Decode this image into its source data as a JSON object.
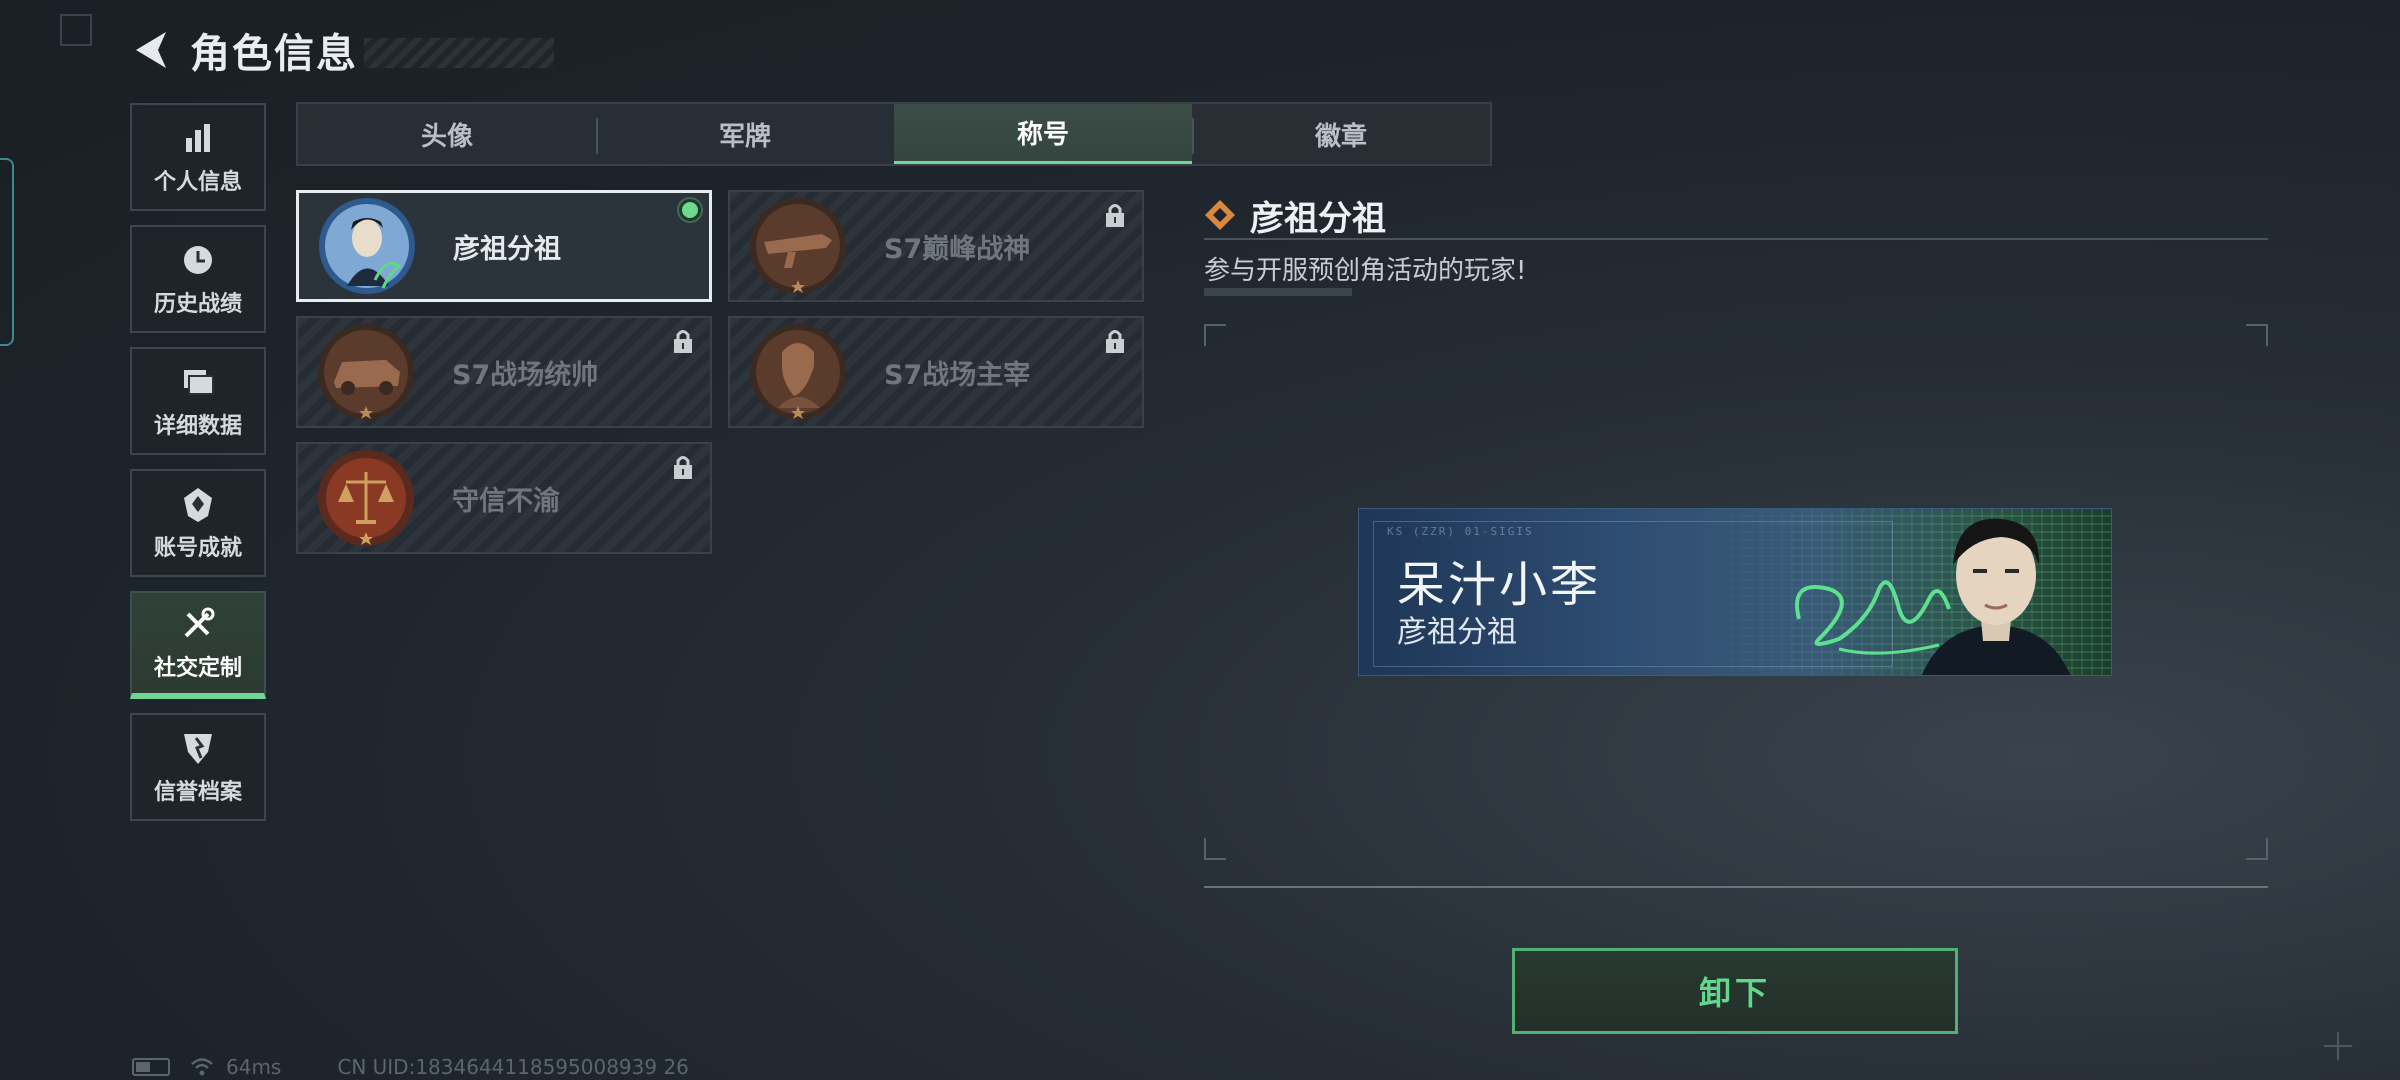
{
  "header": {
    "title": "角色信息"
  },
  "sidebar": {
    "items": [
      {
        "label": "个人信息",
        "icon": "bar-chart-icon"
      },
      {
        "label": "历史战绩",
        "icon": "clock-icon"
      },
      {
        "label": "详细数据",
        "icon": "folder-icon"
      },
      {
        "label": "账号成就",
        "icon": "badge-icon"
      },
      {
        "label": "社交定制",
        "icon": "tools-icon",
        "active": true
      },
      {
        "label": "信誉档案",
        "icon": "shield-icon"
      }
    ]
  },
  "tabs": [
    {
      "label": "头像"
    },
    {
      "label": "军牌"
    },
    {
      "label": "称号",
      "active": true
    },
    {
      "label": "徽章"
    }
  ],
  "titles": [
    {
      "label": "彦祖分祖",
      "selected": true,
      "locked": false
    },
    {
      "label": "S7巅峰战神",
      "selected": false,
      "locked": true
    },
    {
      "label": "S7战场统帅",
      "selected": false,
      "locked": true
    },
    {
      "label": "S7战场主宰",
      "selected": false,
      "locked": true
    },
    {
      "label": "守信不渝",
      "selected": false,
      "locked": true
    }
  ],
  "detail": {
    "name": "彦祖分祖",
    "description": "参与开服预创角活动的玩家!"
  },
  "banner": {
    "player_name": "呆汁小李",
    "title": "彦祖分祖",
    "code": "KS   (ZZR)   01-SIGIS"
  },
  "actions": {
    "unequip_label": "卸下"
  },
  "status": {
    "ping": "64ms",
    "uid": "CN UID:1834644118595008939 26"
  },
  "colors": {
    "accent": "#6fd497",
    "button_text": "#62d88d"
  }
}
